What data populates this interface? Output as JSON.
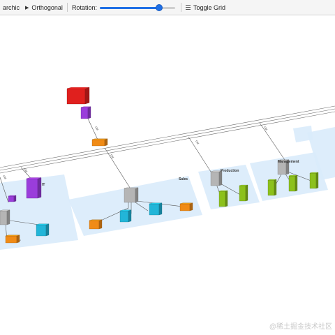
{
  "toolbar": {
    "hierarchic_label": "archic",
    "orthogonal_label": "Orthogonal",
    "rotation_label": "Rotation:",
    "rotation_value": 0.79,
    "toggle_grid_label": "Toggle Grid"
  },
  "diagram": {
    "group_labels": {
      "it": "IT",
      "sales": "Sales",
      "production": "Production",
      "management": "Management"
    },
    "edge_labels": [
      "Util",
      "Util",
      "Util",
      "Util",
      "Util",
      "Util"
    ],
    "colors": {
      "red": "#e0201e",
      "purple": "#9a3ddb",
      "orange": "#f08b16",
      "gray": "#b5b5b5",
      "cyan": "#22b5d8",
      "green": "#8cc11c",
      "group_fill": "#d9ebfb"
    }
  },
  "watermark": "@稀土掘金技术社区"
}
